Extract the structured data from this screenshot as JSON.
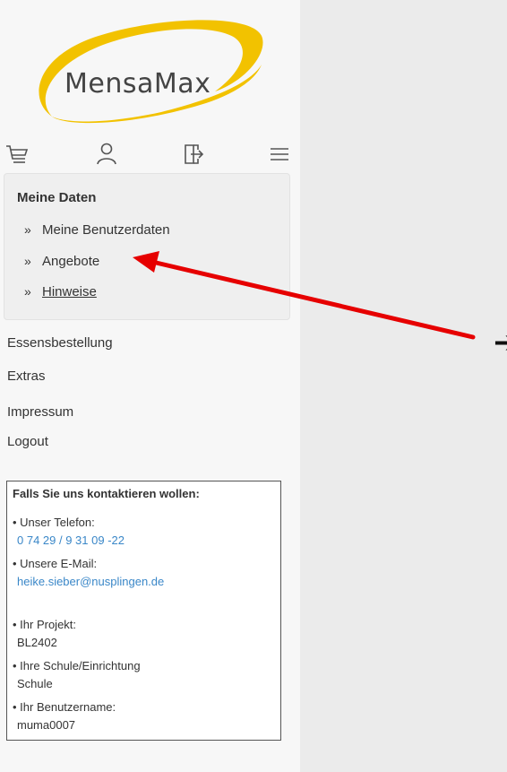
{
  "logo": {
    "text": "MensaMax"
  },
  "toolbar": {
    "icons": [
      "cart-icon",
      "user-icon",
      "logout-door-icon",
      "hamburger-menu-icon"
    ]
  },
  "submenu": {
    "title": "Meine Daten",
    "items": [
      {
        "prefix": "»",
        "label": "Meine Benutzerdaten"
      },
      {
        "prefix": "»",
        "label": "Angebote"
      },
      {
        "prefix": "»",
        "label": "Hinweise"
      }
    ]
  },
  "nav": {
    "items": [
      "Essensbestellung",
      "Extras",
      "Impressum",
      "Logout"
    ]
  },
  "contact": {
    "title": "Falls Sie uns kontaktieren wollen:",
    "phone_label": "• Unser Telefon:",
    "phone_value": "0 74 29 / 9 31 09 -22",
    "email_label": "• Unsere E-Mail:",
    "email_value": "heike.sieber@nusplingen.de",
    "project_label": "• Ihr Projekt:",
    "project_value": "BL2402",
    "school_label": "• Ihre Schule/Einrichtung",
    "school_value": "Schule",
    "username_label": "• Ihr Benutzername:",
    "username_value": "muma0007"
  },
  "annotation": {
    "arrow_glyph": "➔",
    "colors": {
      "arrow": "#e60000",
      "logo_swoosh": "#f2c200",
      "link": "#3a87c8"
    }
  }
}
